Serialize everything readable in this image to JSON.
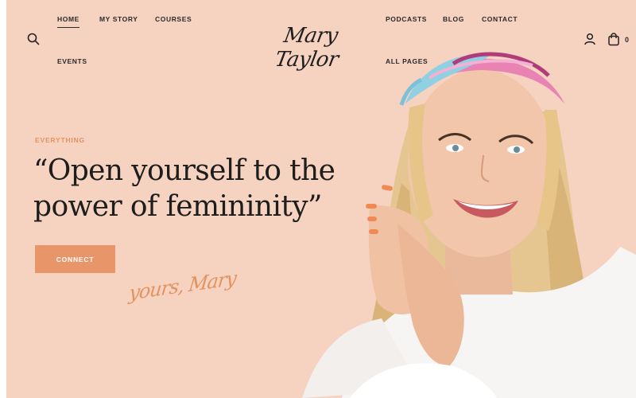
{
  "nav": {
    "left": [
      {
        "label": "HOME",
        "active": true
      },
      {
        "label": "MY STORY"
      },
      {
        "label": "COURSES"
      },
      {
        "label": "EVENTS"
      }
    ],
    "right": [
      {
        "label": "PODCASTS"
      },
      {
        "label": "BLOG"
      },
      {
        "label": "CONTACT"
      },
      {
        "label": "ALL PAGES"
      }
    ]
  },
  "logo": {
    "text": "Mary Taylor"
  },
  "cart": {
    "count": "0"
  },
  "hero": {
    "eyebrow": "EVERYTHING",
    "headline": "“Open yourself to the power of femininity”",
    "cta_label": "CONNECT",
    "signature": "yours, Mary"
  },
  "colors": {
    "background": "#f6d2c0",
    "accent": "#e8956a",
    "text": "#1d1d1d"
  },
  "icons": [
    "search-icon",
    "user-icon",
    "shopping-bag-icon"
  ]
}
